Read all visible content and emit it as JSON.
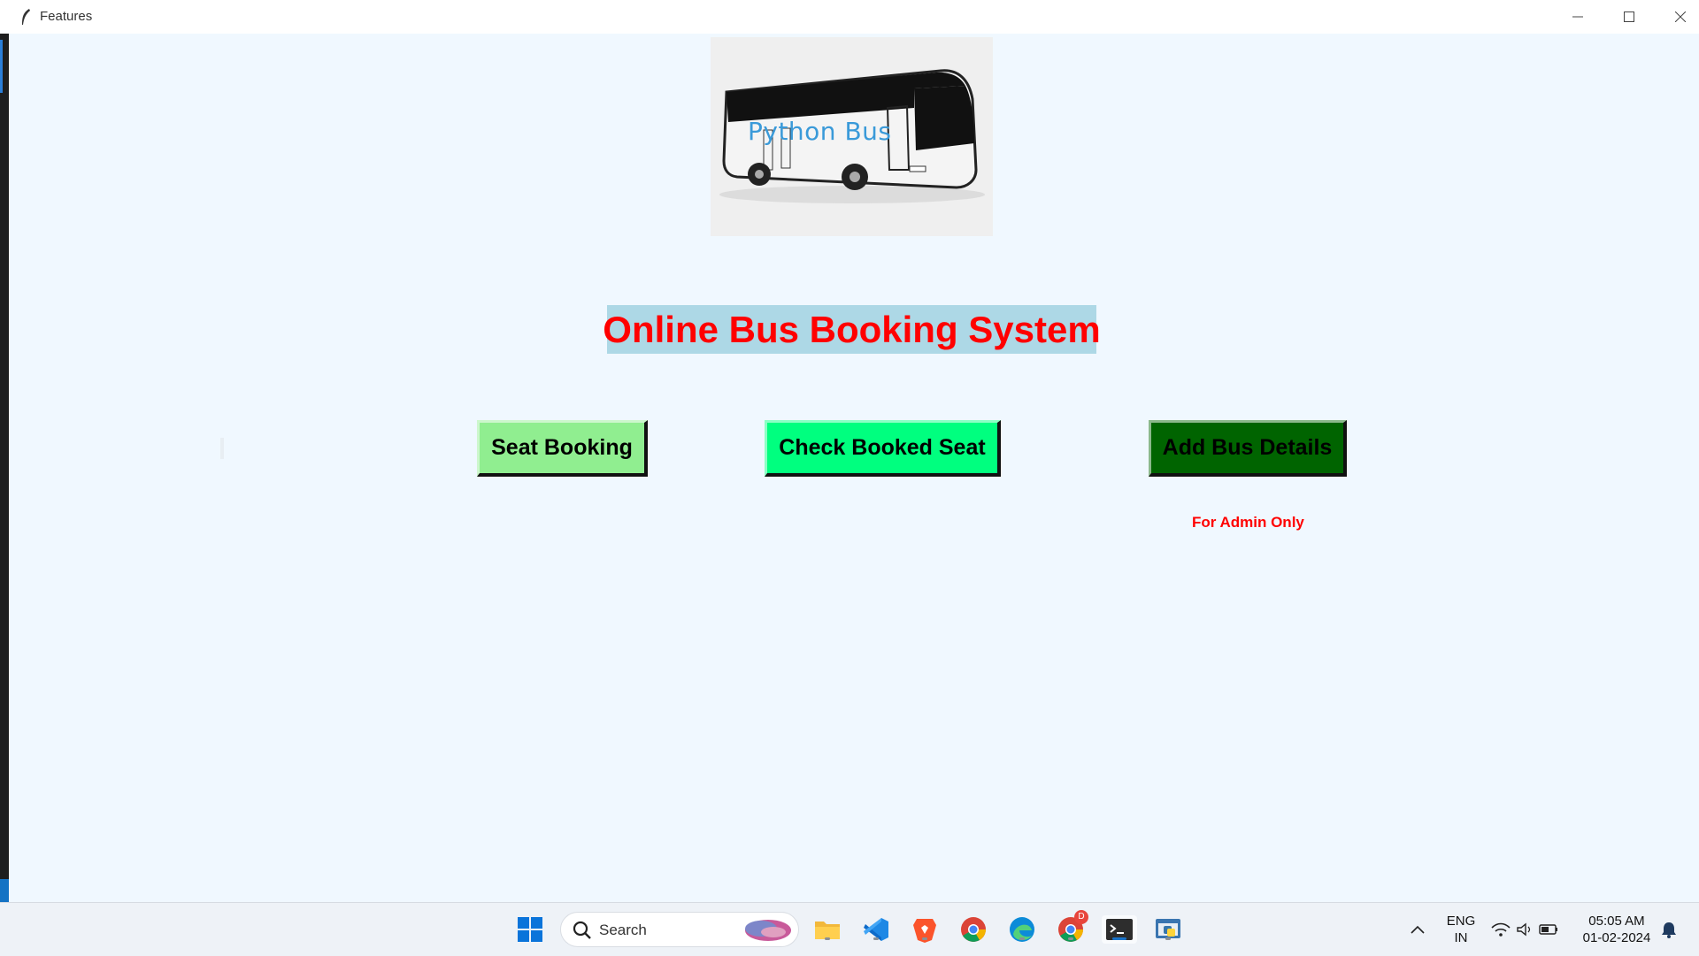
{
  "window": {
    "title": "Features"
  },
  "logo": {
    "text": "Python Bus"
  },
  "main": {
    "heading": "Online Bus Booking System",
    "buttons": {
      "seat_booking": "Seat Booking",
      "check_booked": "Check Booked Seat",
      "add_bus": "Add Bus Details"
    },
    "admin_note": "For Admin Only"
  },
  "colors": {
    "background": "#f0f8ff",
    "heading_bg": "#add8e6",
    "heading_text": "#ff0000",
    "seat_booking_bg": "#90ee90",
    "check_booked_bg": "#00ff7f",
    "add_bus_bg": "#006400"
  },
  "taskbar": {
    "search_placeholder": "Search",
    "icons": [
      "windows-start-icon",
      "search-icon",
      "file-explorer-icon",
      "vscode-icon",
      "brave-icon",
      "chrome-icon",
      "edge-icon",
      "chrome-profile-icon",
      "terminal-icon",
      "python-icon"
    ],
    "chrome_badge": "D",
    "language": "ENG",
    "region": "IN",
    "time": "05:05 AM",
    "date": "01-02-2024"
  }
}
